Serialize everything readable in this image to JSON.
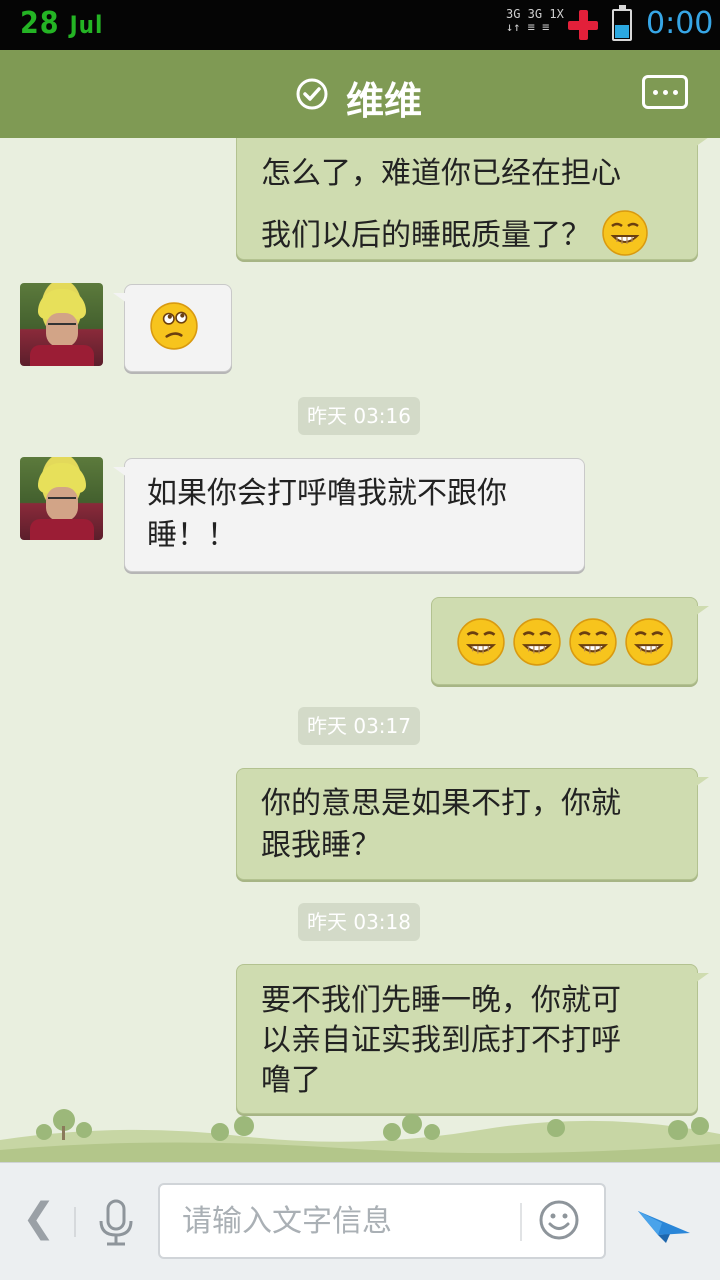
{
  "status_bar": {
    "date_day": "28",
    "date_month": "Jul",
    "network_line1": "3G 3G 1X",
    "network_line2": "↓↑ ≡ ≡",
    "time": "0:00",
    "battery_level": 0.45
  },
  "header": {
    "title": "维维",
    "verified_icon": "check-circle-icon",
    "menu_icon": "more-dots-icon"
  },
  "messages": [
    {
      "side": "out",
      "lines": [
        "怎么了，难道你已经在担心",
        "我们以后的睡眠质量了？"
      ],
      "emoji_after": [
        "grin-emoji"
      ]
    },
    {
      "side": "in",
      "emoji_only": [
        "confused-emoji"
      ]
    },
    {
      "type": "timestamp",
      "text": "昨天 03:16"
    },
    {
      "side": "in",
      "text": "如果你会打呼噜我就不跟你睡！！"
    },
    {
      "side": "out",
      "emoji_only": [
        "grin-emoji",
        "grin-emoji",
        "grin-emoji",
        "grin-emoji"
      ]
    },
    {
      "type": "timestamp",
      "text": "昨天 03:17"
    },
    {
      "side": "out",
      "text": "你的意思是如果不打，你就跟我睡？"
    },
    {
      "type": "timestamp",
      "text": "昨天 03:18"
    },
    {
      "side": "out",
      "text": "要不我们先睡一晚，你就可以亲自证实我到底打不打呼噜了"
    }
  ],
  "m1_line1": "怎么了，难道你已经在担心",
  "m1_line2": "我们以后的睡眠质量了？",
  "ts1": "昨天 03:16",
  "m3_line1": "如果你会打呼噜我就不跟你",
  "m3_line2": "睡！！",
  "ts2": "昨天 03:17",
  "m5_line1": "你的意思是如果不打，你就",
  "m5_line2": "跟我睡？",
  "ts3": "昨天 03:18",
  "m6_line1": "要不我们先睡一晚，你就可",
  "m6_line2": "以亲自证实我到底打不打呼",
  "m6_line3": "噜了",
  "input": {
    "placeholder": "请输入文字信息",
    "value": ""
  },
  "colors": {
    "header": "#7f9a54",
    "chat_bg": "#e9efdf",
    "out_bubble": "#cfdcb0",
    "in_bubble": "#f3f3f3",
    "status_date": "#24b424",
    "status_time": "#37a6e6",
    "send": "#2a86d8"
  },
  "bottom_bar": {
    "icons": [
      "back-arrow-icon",
      "microphone-icon",
      "smiley-icon",
      "send-icon"
    ]
  }
}
